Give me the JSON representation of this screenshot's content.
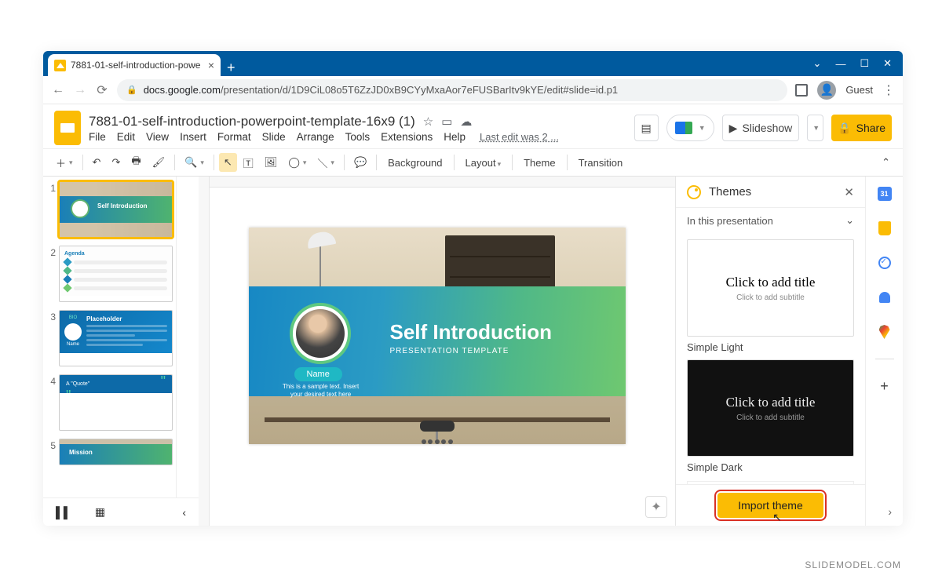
{
  "browser": {
    "tab_title": "7881-01-self-introduction-powe",
    "url_host": "docs.google.com",
    "url_path": "/presentation/d/1D9CiL08o5T6ZzJD0xB9CYyMxaAor7eFUSBarItv9kYE/edit#slide=id.p1",
    "guest_label": "Guest"
  },
  "doc": {
    "title": "7881-01-self-introduction-powerpoint-template-16x9 (1)",
    "last_edit": "Last edit was 2 ...",
    "menus": [
      "File",
      "Edit",
      "View",
      "Insert",
      "Format",
      "Slide",
      "Arrange",
      "Tools",
      "Extensions",
      "Help"
    ]
  },
  "header_buttons": {
    "slideshow": "Slideshow",
    "share": "Share"
  },
  "toolbar": {
    "background": "Background",
    "layout": "Layout",
    "theme": "Theme",
    "transition": "Transition"
  },
  "filmstrip": {
    "slides": [
      {
        "num": "1",
        "title": "Self Introduction"
      },
      {
        "num": "2",
        "title": "Agenda"
      },
      {
        "num": "3",
        "title": "Placeholder",
        "bio": "BIO",
        "name": "Name"
      },
      {
        "num": "4",
        "title": "A \"Quote\""
      },
      {
        "num": "5",
        "title": "Mission"
      }
    ]
  },
  "canvas": {
    "title": "Self Introduction",
    "subtitle": "PRESENTATION TEMPLATE",
    "name_pill": "Name",
    "sample_text": "This is a sample text. Insert your desired text here"
  },
  "themes_panel": {
    "title": "Themes",
    "section": "In this presentation",
    "card_title": "Click to add title",
    "card_subtitle": "Click to add subtitle",
    "theme1_label": "Simple Light",
    "theme2_label": "Simple Dark",
    "import_button": "Import theme"
  },
  "watermark": "SLIDEMODEL.COM"
}
